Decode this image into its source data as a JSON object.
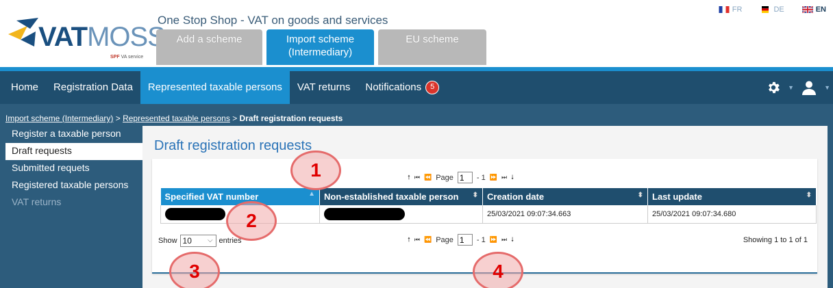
{
  "logo": {
    "brand_bold": "VAT",
    "brand_light": "MOSS",
    "sub_prefix": "SPF",
    "sub_suffix": "VA service"
  },
  "app_title": "One Stop Shop - VAT on goods and services",
  "top_tabs": [
    {
      "line1": "Add a scheme",
      "line2": ""
    },
    {
      "line1": "Import scheme",
      "line2": "(Intermediary)"
    },
    {
      "line1": "EU scheme",
      "line2": ""
    }
  ],
  "languages": [
    {
      "code": "FR",
      "flag": "flag-fr-icon"
    },
    {
      "code": "DE",
      "flag": "flag-de-icon"
    },
    {
      "code": "EN",
      "flag": "flag-uk-icon"
    }
  ],
  "nav": {
    "items": [
      "Home",
      "Registration Data",
      "Represented taxable persons",
      "VAT returns",
      "Notifications"
    ],
    "notification_count": "5",
    "icons": [
      "gear-icon",
      "user-icon"
    ]
  },
  "breadcrumb": {
    "link1": "Import scheme (Intermediary)",
    "sep1": " > ",
    "link2": "Represented taxable persons",
    "sep2": " > ",
    "current": "Draft registration requests"
  },
  "sidebar": {
    "items": [
      "Register a taxable person",
      "Draft requests",
      "Submitted requets",
      "Registered taxable persons",
      "VAT returns"
    ]
  },
  "page_title": "Draft registration requests",
  "pager": {
    "page_label": "Page",
    "page_value": "1",
    "of_text": "- 1"
  },
  "table": {
    "headers": [
      "Specified VAT number",
      "Non-established taxable person",
      "Creation date",
      "Last update"
    ],
    "rows": [
      {
        "creation_date": "25/03/2021 09:07:34.663",
        "last_update": "25/03/2021 09:07:34.680"
      }
    ]
  },
  "length": {
    "show_label": "Show",
    "value": "10",
    "entries_label": "entries"
  },
  "showing": "Showing 1 to 1 of 1",
  "callouts": [
    "1",
    "2",
    "3",
    "4"
  ],
  "colors": {
    "nav": "#1f4e6e",
    "accent": "#1b8fcf",
    "band": "#2d5c7c",
    "callout": "#e00000"
  }
}
